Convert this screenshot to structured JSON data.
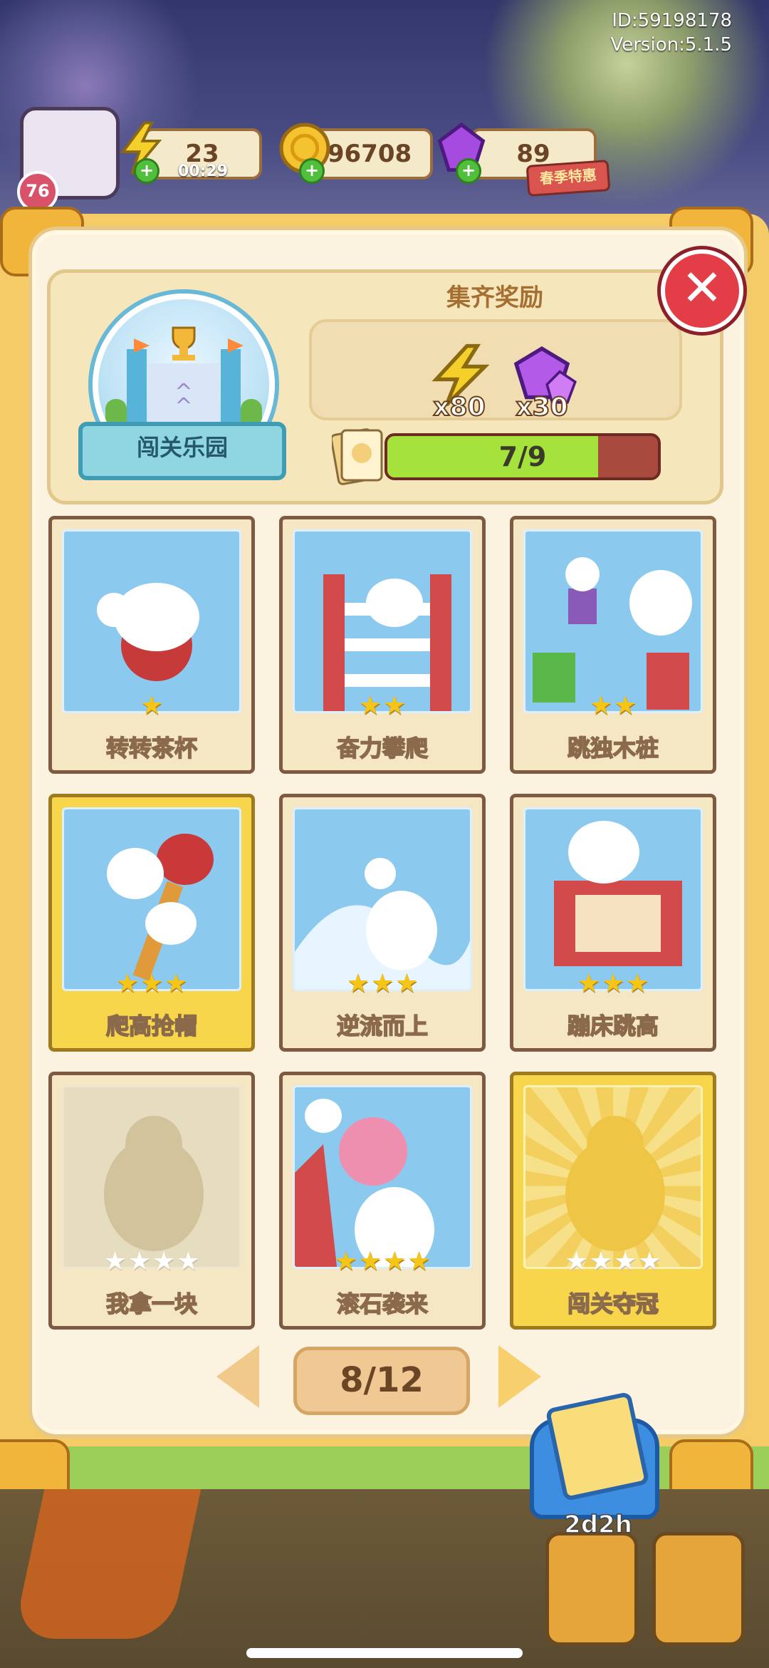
{
  "hud": {
    "id_text": "ID:59198178",
    "version_text": "Version:5.1.5",
    "level": "76",
    "energy": "23",
    "energy_timer": "00:29",
    "coins": "96708",
    "gems": "89",
    "spring_tag": "春季特惠"
  },
  "album": {
    "theme_name": "闯关乐园",
    "reward_title": "集齐奖励",
    "rewards": [
      {
        "icon": "lightning-icon",
        "qty": "x80"
      },
      {
        "icon": "gem-icon",
        "qty": "x30"
      }
    ],
    "progress_text": "7/9",
    "progress_fraction": 0.778,
    "close_label": "✕"
  },
  "cards": [
    {
      "name": "转转茶杯",
      "stars": 1,
      "max": 1,
      "gold": false,
      "collected": true
    },
    {
      "name": "奋力攀爬",
      "stars": 2,
      "max": 2,
      "gold": false,
      "collected": true
    },
    {
      "name": "跳独木桩",
      "stars": 2,
      "max": 2,
      "gold": false,
      "collected": true
    },
    {
      "name": "爬高抢帽",
      "stars": 3,
      "max": 3,
      "gold": true,
      "collected": true
    },
    {
      "name": "逆流而上",
      "stars": 3,
      "max": 3,
      "gold": false,
      "collected": true
    },
    {
      "name": "蹦床跳高",
      "stars": 3,
      "max": 3,
      "gold": false,
      "collected": true
    },
    {
      "name": "我拿一块",
      "stars": 0,
      "max": 4,
      "gold": false,
      "collected": false
    },
    {
      "name": "滚石袭来",
      "stars": 4,
      "max": 4,
      "gold": false,
      "collected": true
    },
    {
      "name": "闯关夺冠",
      "stars": 0,
      "max": 4,
      "gold": true,
      "collected": false
    }
  ],
  "pager": {
    "label": "8/12"
  },
  "pack": {
    "timer": "2d2h"
  },
  "colors": {
    "accent": "#a5e33c",
    "gold_card": "#f8d64c",
    "close": "#e33e48"
  }
}
